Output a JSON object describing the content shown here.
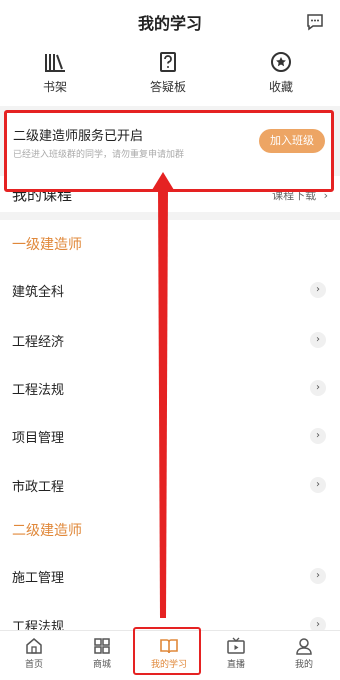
{
  "header": {
    "title": "我的学习",
    "message_icon": "message-icon"
  },
  "quick_links": [
    {
      "label": "书架",
      "icon": "bookshelf-icon"
    },
    {
      "label": "答疑板",
      "icon": "question-board-icon"
    },
    {
      "label": "收藏",
      "icon": "star-favorite-icon"
    }
  ],
  "banner": {
    "title": "二级建造师服务已开启",
    "subtitle": "已经进入班级群的同学，请勿重复申请加群",
    "button": "加入班级"
  },
  "my_courses": {
    "title": "我的课程",
    "download": "课程下载"
  },
  "sections": [
    {
      "title": "一级建造师",
      "courses": [
        "建筑全科",
        "工程经济",
        "工程法规",
        "项目管理",
        "市政工程"
      ]
    },
    {
      "title": "二级建造师",
      "courses": [
        "施工管理",
        "工程法规"
      ]
    }
  ],
  "tabbar": [
    {
      "label": "首页",
      "icon": "home-icon"
    },
    {
      "label": "商城",
      "icon": "grid-icon"
    },
    {
      "label": "我的学习",
      "icon": "open-book-icon",
      "active": true
    },
    {
      "label": "直播",
      "icon": "tv-icon"
    },
    {
      "label": "我的",
      "icon": "user-icon"
    }
  ],
  "colors": {
    "accent": "#e0883a",
    "button": "#eda564",
    "highlight": "#e52222"
  }
}
